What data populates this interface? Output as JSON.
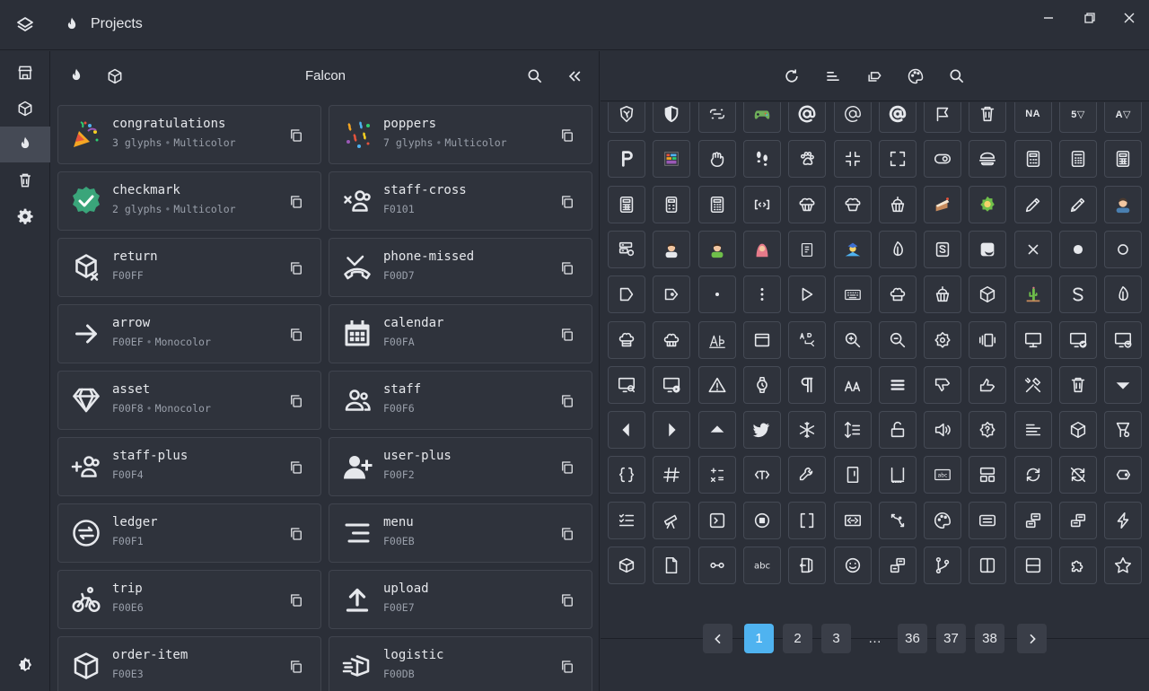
{
  "window": {
    "title": "Projects"
  },
  "rail": {
    "items": [
      {
        "icon": "store-icon",
        "active": false
      },
      {
        "icon": "cube-icon",
        "active": false
      },
      {
        "icon": "flame-icon",
        "active": true
      },
      {
        "icon": "trash-icon",
        "active": false
      },
      {
        "icon": "gear-icon",
        "active": false
      }
    ],
    "bottom_icon": "theme-toggle-icon"
  },
  "middle": {
    "project_name": "Falcon",
    "cards": [
      {
        "name": "congratulations",
        "code": "3 glyphs",
        "tag": "Multicolor",
        "icon": "party-popper-icon"
      },
      {
        "name": "poppers",
        "code": "7 glyphs",
        "tag": "Multicolor",
        "icon": "confetti-icon"
      },
      {
        "name": "checkmark",
        "code": "2 glyphs",
        "tag": "Multicolor",
        "icon": "checkmark-badge-icon"
      },
      {
        "name": "staff-cross",
        "code": "F0101",
        "tag": "",
        "icon": "staff-cross-icon"
      },
      {
        "name": "return",
        "code": "F00FF",
        "tag": "",
        "icon": "return-box-icon"
      },
      {
        "name": "phone-missed",
        "code": "F00D7",
        "tag": "",
        "icon": "phone-missed-icon"
      },
      {
        "name": "arrow",
        "code": "F00EF",
        "tag": "Monocolor",
        "icon": "arrow-right-icon"
      },
      {
        "name": "calendar",
        "code": "F00FA",
        "tag": "",
        "icon": "calendar-icon"
      },
      {
        "name": "asset",
        "code": "F00F8",
        "tag": "Monocolor",
        "icon": "diamond-icon"
      },
      {
        "name": "staff",
        "code": "F00F6",
        "tag": "",
        "icon": "staff-icon"
      },
      {
        "name": "staff-plus",
        "code": "F00F4",
        "tag": "",
        "icon": "staff-plus-icon"
      },
      {
        "name": "user-plus",
        "code": "F00F2",
        "tag": "",
        "icon": "user-plus-icon"
      },
      {
        "name": "ledger",
        "code": "F00F1",
        "tag": "",
        "icon": "ledger-icon"
      },
      {
        "name": "menu",
        "code": "F00EB",
        "tag": "",
        "icon": "menu-icon"
      },
      {
        "name": "trip",
        "code": "F00E6",
        "tag": "",
        "icon": "bicycle-icon"
      },
      {
        "name": "upload",
        "code": "F00E7",
        "tag": "",
        "icon": "upload-icon"
      },
      {
        "name": "order-item",
        "code": "F00E3",
        "tag": "",
        "icon": "order-box-icon"
      },
      {
        "name": "logistic",
        "code": "F00DB",
        "tag": "",
        "icon": "fast-box-icon"
      }
    ]
  },
  "right": {
    "grid": [
      [
        "crest",
        "shield",
        "link-broken",
        "gamepad",
        "at-bold",
        "at-thin",
        "at-heavy",
        "flag-outline",
        "trash",
        {
          "t": "NA"
        },
        {
          "t": "5▽"
        },
        {
          "t": "A▽"
        }
      ],
      [
        "parking",
        "colorful-box",
        "fist",
        "footprints",
        "paw",
        "minimize",
        "maximize",
        "toggle",
        "burger",
        "calculator",
        "calculator-2",
        "calculator-3"
      ],
      [
        "calculator-4",
        "calculator-5",
        "calculator-6",
        "code-box",
        "muffin",
        "muffin-2",
        "cupcake",
        "cake-slice",
        "sun-badge",
        "pencil",
        "pencil-2",
        "user-avatar"
      ],
      [
        "server-cog",
        "person-avatar",
        "person-avatar-2",
        "hijab-avatar",
        "tag-box",
        "cap-avatar",
        "leaf",
        "s-box",
        "moon-card",
        "close",
        "circle-filled",
        "circle"
      ],
      [
        "tag-shape",
        "tag-dot",
        "dot",
        "more-vertical",
        "play-outline",
        "keyboard",
        "chef-hat",
        "cupcake-2",
        "cube-3d",
        "cactus",
        "s-swirl",
        "leaf-2"
      ],
      [
        "chef-hat-2",
        "chef-hat-3",
        "text-ab",
        "window",
        "swap-text",
        "zoom-in",
        "zoom-out",
        "badge-settings",
        "carousel",
        "monitor",
        "monitor-check",
        "monitor-clock"
      ],
      [
        "monitor-search",
        "monitor-play",
        "warning",
        "watch",
        "pilcrow",
        "font-size",
        "menu-bold",
        "thumbs-down",
        "thumbs-up",
        "tools",
        "trash-2",
        "caret-down"
      ],
      [
        "caret-left",
        "caret-right",
        "caret-up",
        "twitter",
        "snowflake",
        "align-distribute",
        "unlock",
        "volume",
        "badge-question",
        "list-text",
        "cube-outline",
        "shapes"
      ],
      [
        "braces",
        "hash",
        "math-ops",
        "text-tag",
        "wrench",
        "book-mark",
        "frame-dotted",
        "abc-box",
        "layout-split",
        "sync",
        "sync-off",
        "tags"
      ],
      [
        "checklist",
        "telescope",
        "terminal",
        "stop-circle",
        "brackets",
        "code-swap",
        "route-arrow",
        "palette",
        "message-box",
        "boxes",
        "boxes-2",
        "lightning"
      ],
      [
        "box-open",
        "file",
        "key-line",
        "text-abc",
        "door-exit",
        "smile",
        "boxes-3",
        "git-branch",
        "columns",
        "rows",
        "puzzle",
        "star"
      ]
    ],
    "pagination": {
      "pages": [
        "1",
        "2",
        "3",
        "…",
        "36",
        "37",
        "38"
      ],
      "active": "1"
    }
  }
}
